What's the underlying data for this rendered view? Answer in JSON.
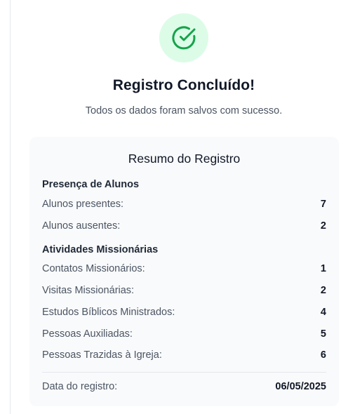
{
  "header": {
    "icon": "check-circle-icon",
    "title": "Registro Concluído!",
    "subtitle": "Todos os dados foram salvos com sucesso."
  },
  "summary": {
    "title": "Resumo do Registro",
    "attendance": {
      "heading": "Presença de Alunos",
      "rows": [
        {
          "label": "Alunos presentes:",
          "value": "7"
        },
        {
          "label": "Alunos ausentes:",
          "value": "2"
        }
      ]
    },
    "missionary": {
      "heading": "Atividades Missionárias",
      "rows": [
        {
          "label": "Contatos Missionários:",
          "value": "1"
        },
        {
          "label": "Visitas Missionárias:",
          "value": "2"
        },
        {
          "label": "Estudos Bíblicos Ministrados:",
          "value": "4"
        },
        {
          "label": "Pessoas Auxiliadas:",
          "value": "5"
        },
        {
          "label": "Pessoas Trazidas à Igreja:",
          "value": "6"
        }
      ]
    },
    "date": {
      "label": "Data do registro:",
      "value": "06/05/2025"
    }
  },
  "colors": {
    "success_bg": "#dcfce7",
    "success_icon": "#16a34a",
    "card_bg": "#f9fafb"
  }
}
